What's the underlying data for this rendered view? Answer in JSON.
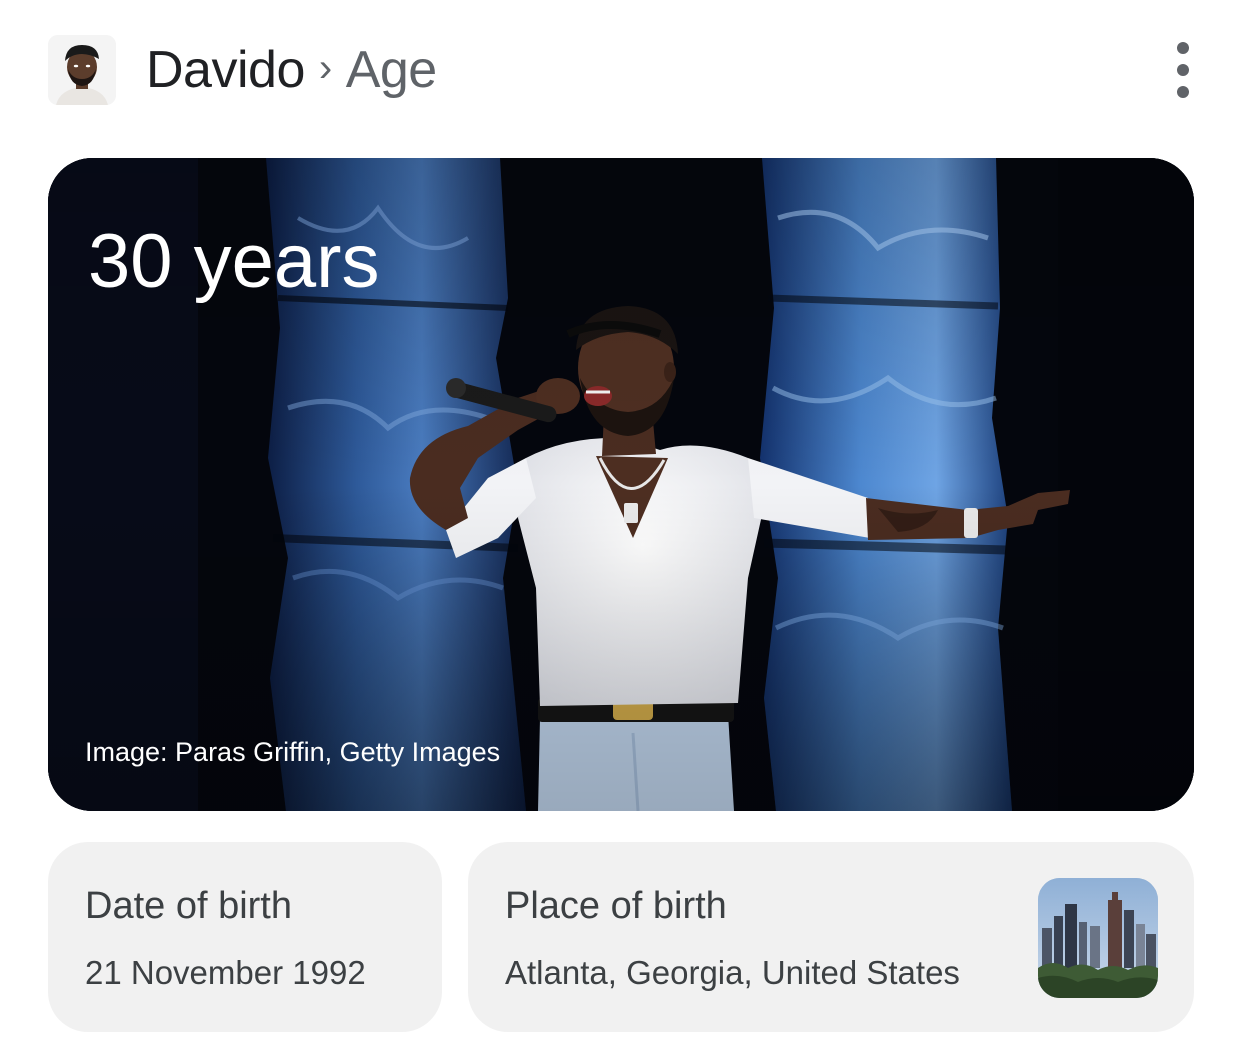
{
  "header": {
    "entity": "Davido",
    "separator": "›",
    "attribute": "Age"
  },
  "hero": {
    "age": "30 years",
    "credit": "Image: Paras Griffin, Getty Images"
  },
  "cards": {
    "date_of_birth": {
      "label": "Date of birth",
      "value": "21 November 1992"
    },
    "place_of_birth": {
      "label": "Place of birth",
      "value": "Atlanta, Georgia, United States"
    }
  },
  "icons": {
    "more": "more-vert-icon"
  },
  "colors": {
    "title": "#202124",
    "subtitle": "#5f6368",
    "card_bg": "#f1f1f1",
    "hero_bg": "#05070f"
  }
}
